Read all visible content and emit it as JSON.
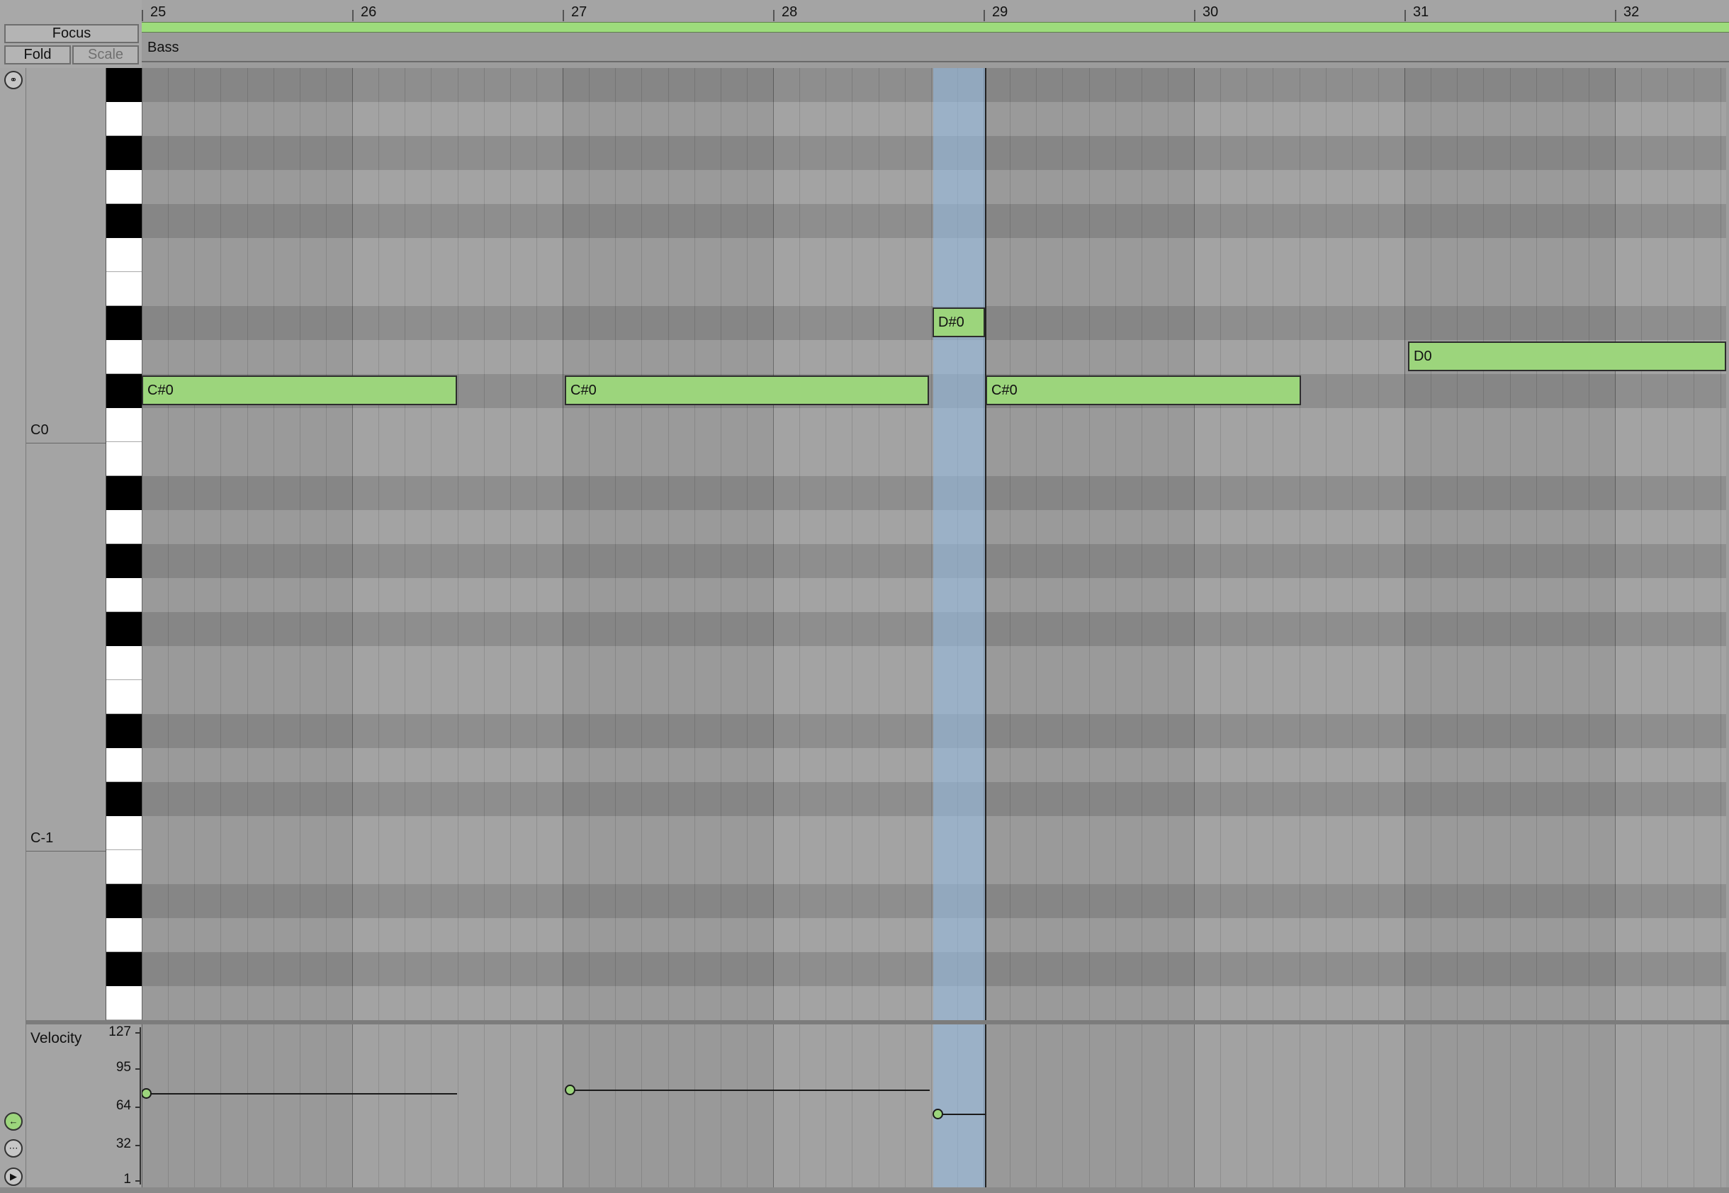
{
  "controls": {
    "focus_label": "Focus",
    "fold_label": "Fold",
    "scale_label": "Scale"
  },
  "ruler": {
    "bars": [
      "25",
      "26",
      "27",
      "28",
      "29",
      "30",
      "31",
      "32"
    ]
  },
  "clip": {
    "name": "Bass"
  },
  "keyboard": {
    "octave_labels": [
      "C0",
      "C-1"
    ]
  },
  "notes": [
    {
      "label": "C#0"
    },
    {
      "label": "C#0"
    },
    {
      "label": "D#0"
    },
    {
      "label": "C#0"
    },
    {
      "label": "D0"
    }
  ],
  "velocity": {
    "title": "Velocity",
    "ticks": [
      "127",
      "95",
      "64",
      "32",
      "1"
    ]
  },
  "colors": {
    "note_fill": "#9cd57c",
    "loop_bar": "#9ddc7c",
    "selection": "#a8c0d8"
  },
  "icons": {
    "headphones": "headphones-icon",
    "velocity_toggle": "velocity-lane-icon",
    "chance_toggle": "chance-lane-icon",
    "play_toggle": "play-icon"
  }
}
